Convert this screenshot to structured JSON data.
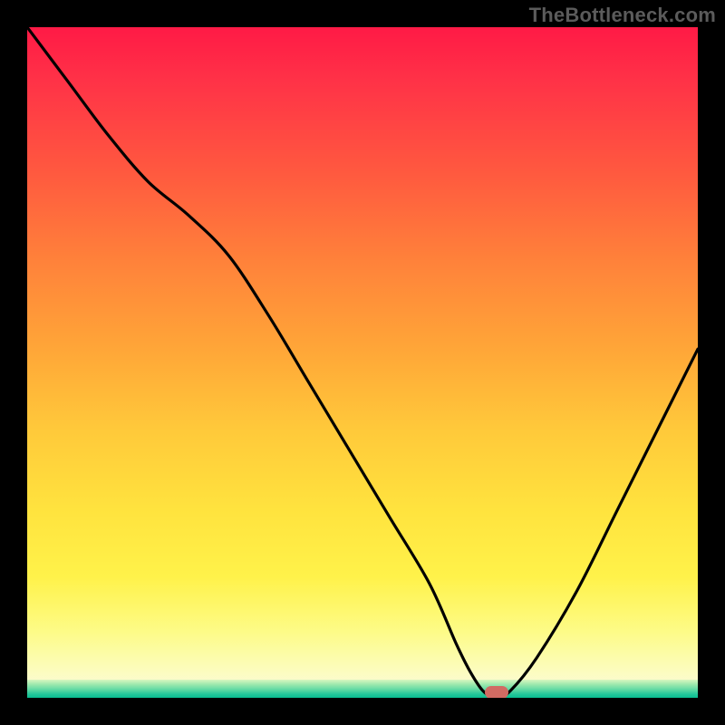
{
  "watermark": "TheBottleneck.com",
  "chart_data": {
    "type": "line",
    "title": "",
    "xlabel": "",
    "ylabel": "",
    "xlim": [
      0,
      100
    ],
    "ylim": [
      0,
      100
    ],
    "grid": false,
    "series": [
      {
        "name": "curve",
        "x": [
          0,
          6,
          12,
          18,
          24,
          30,
          36,
          42,
          48,
          54,
          60,
          64,
          66,
          68,
          70,
          72,
          76,
          82,
          88,
          94,
          100
        ],
        "y": [
          100,
          92,
          84,
          77,
          72,
          66,
          57,
          47,
          37,
          27,
          17,
          8,
          4,
          1,
          0,
          1,
          6,
          16,
          28,
          40,
          52
        ]
      }
    ],
    "marker": {
      "x": 70,
      "y": 0.8
    },
    "gradient_stops": {
      "top": "#ff1a46",
      "mid": "#ffe33e",
      "bottom_band_top": "#d8f6bf",
      "bottom_band_bot": "#09bd8f"
    }
  }
}
